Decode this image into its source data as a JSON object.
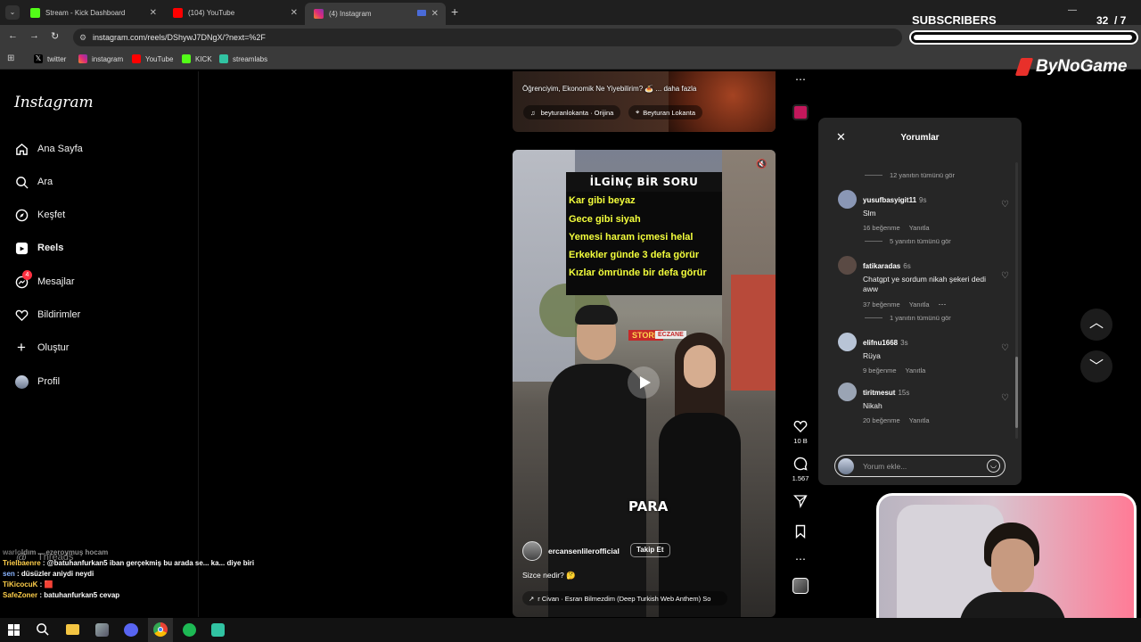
{
  "browser": {
    "tabs": [
      {
        "title": "Stream - Kick Dashboard",
        "color": "#53fc18"
      },
      {
        "title": "(104) YouTube",
        "color": "#ff0000"
      },
      {
        "title": "(4) Instagram",
        "color": "#e1306c"
      }
    ],
    "url": "instagram.com/reels/DShywJ7DNgX/?next=%2F",
    "bookmarks": [
      {
        "label": "twitter"
      },
      {
        "label": "instagram"
      },
      {
        "label": "YouTube"
      },
      {
        "label": "KICK"
      },
      {
        "label": "streamlabs"
      }
    ]
  },
  "overlay": {
    "subscribers_label": "SUBSCRIBERS",
    "subscribers_count": "32",
    "subscribers_goal": "/ 7",
    "brand": "ByNoGame"
  },
  "sidebar": {
    "logo": "Instagram",
    "items": [
      {
        "label": "Ana Sayfa",
        "icon": "home-icon"
      },
      {
        "label": "Ara",
        "icon": "search-icon"
      },
      {
        "label": "Keşfet",
        "icon": "compass-icon"
      },
      {
        "label": "Reels",
        "icon": "reels-icon"
      },
      {
        "label": "Mesajlar",
        "icon": "messenger-icon",
        "badge": "4"
      },
      {
        "label": "Bildirimler",
        "icon": "heart-icon"
      },
      {
        "label": "Oluştur",
        "icon": "plus-icon"
      },
      {
        "label": "Profil",
        "icon": "avatar"
      }
    ],
    "threads": "Threads"
  },
  "reel_top": {
    "caption": "Öğrenciyim, Ekonomik Ne Yiyebilirim? 🍝 ... daha fazla",
    "audio": "beyturanlokanta · Orijina",
    "location": "Beyturan Lokanta"
  },
  "reel_main": {
    "banner_title": "İLGİNÇ BİR SORU",
    "banner_lines": [
      "Kar gibi beyaz",
      "Gece gibi siyah",
      "Yemesi haram içmesi helal",
      "Erkekler günde 3 defa görür",
      "Kızlar ömründe bir defa görür"
    ],
    "shop_sign": "STORE",
    "pharmacy_sign": "ECZANE",
    "bottom_word": "PARA",
    "author": "ercansenlilerofficial",
    "follow": "Takip Et",
    "caption": "Sizce nedir? 🤔",
    "audio": "r Civan · Esran Bilmezdim (Deep Turkish Web Anthem)  So",
    "likes": "10 B",
    "comments": "1.567"
  },
  "comments_panel": {
    "title": "Yorumlar",
    "top_replies": "12 yanıtın tümünü gör",
    "comments": [
      {
        "user": "yusufbasyigit11",
        "time": "9s",
        "text": "Slm",
        "likes": "16 beğenme",
        "reply": "Yanıtla",
        "replies": "5 yanıtın tümünü gör",
        "avatar_color": "#8a97b5"
      },
      {
        "user": "fatikaradas",
        "time": "6s",
        "text": "Chatgpt ye sordum nikah şekeri dedi aww",
        "likes": "37 beğenme",
        "reply": "Yanıtla",
        "replies": "1 yanıtın tümünü gör",
        "avatar_color": "#5a4a44"
      },
      {
        "user": "elifnu1668",
        "time": "3s",
        "text": "Rüya",
        "likes": "9 beğenme",
        "reply": "Yanıtla",
        "replies": "",
        "avatar_color": "#b8c4d6"
      },
      {
        "user": "tiritmesut",
        "time": "15s",
        "text": "Nikah",
        "likes": "20 beğenme",
        "reply": "Yanıtla",
        "replies": "",
        "avatar_color": "#9aa4b4"
      }
    ],
    "input_placeholder": "Yorum ekle..."
  },
  "chat": [
    {
      "user": "warlo",
      "text": "ldım ... ezeroymuş hocam",
      "color": "#c9c9c9"
    },
    {
      "user": "Trielbaenre",
      "text": ": @batuhanfurkan5 iban gerçekmiş bu arada se... ka... diye biri",
      "color": "#ffcf4a"
    },
    {
      "user": "sen",
      "text": ": düsüzler aniydi neydi",
      "color": "#8ab4ff"
    },
    {
      "user": "TiKicocuK",
      "text": ": 🟥",
      "color": "#ffcf4a"
    },
    {
      "user": "SafeZoner",
      "text": ": batuhanfurkan5 cevap",
      "color": "#ffcf4a"
    }
  ]
}
